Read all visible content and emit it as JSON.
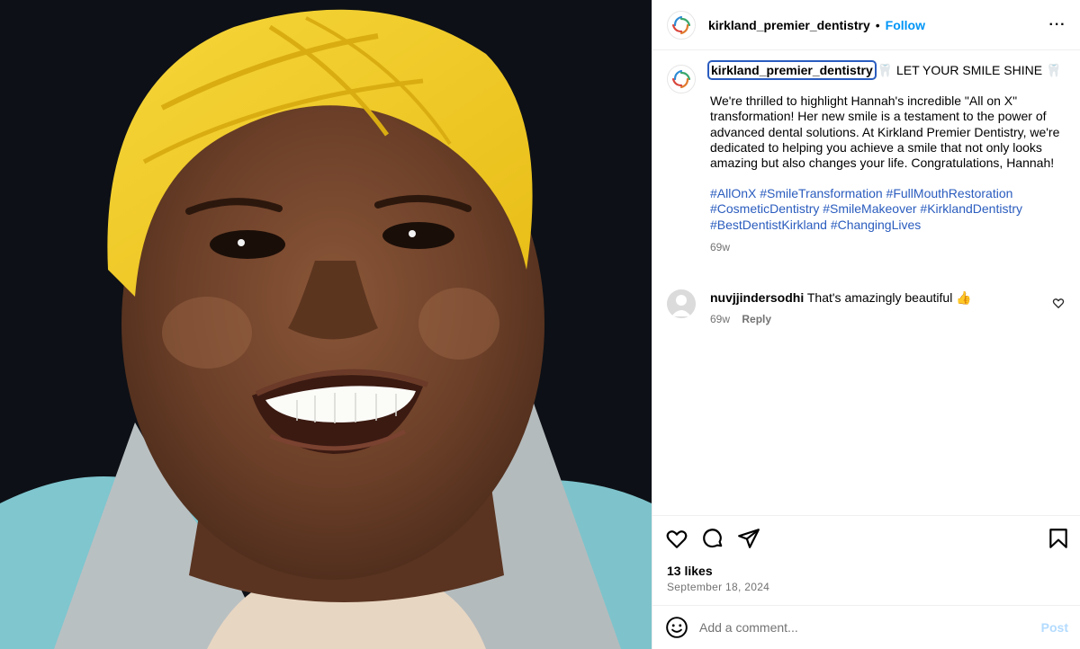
{
  "header": {
    "username": "kirkland_premier_dentistry",
    "separator": "•",
    "follow_label": "Follow",
    "more_label": "···"
  },
  "caption": {
    "username": "kirkland_premier_dentistry",
    "headline": "🦷 LET YOUR SMILE SHINE 🦷",
    "body": "We're thrilled to highlight Hannah's incredible \"All on X\" transformation! Her new smile is a testament to the power of advanced dental solutions. At Kirkland Premier Dentistry, we're dedicated to helping you achieve a smile that not only looks amazing but also changes your life. Congratulations, Hannah!",
    "hashtags": "#AllOnX #SmileTransformation #FullMouthRestoration #CosmeticDentistry #SmileMakeover #KirklandDentistry #BestDentistKirkland #ChangingLives",
    "time": "69w"
  },
  "comments": [
    {
      "username": "nuvjjindersodhi",
      "text": "That's amazingly beautiful 👍",
      "time": "69w",
      "reply_label": "Reply"
    }
  ],
  "actions": {
    "likes": "13 likes",
    "date": "September 18, 2024"
  },
  "add_comment": {
    "placeholder": "Add a comment...",
    "post_label": "Post"
  },
  "icons": {
    "like": "heart-icon",
    "comment": "comment-bubble-icon",
    "share": "paper-plane-icon",
    "save": "bookmark-icon",
    "emoji": "smiley-icon",
    "more": "more-dots-icon"
  },
  "colors": {
    "link_blue": "#0095f6",
    "hashtag_blue": "#2a5cbe",
    "muted_gray": "#737373",
    "post_disabled": "#b3dbff",
    "border": "#efefef"
  }
}
